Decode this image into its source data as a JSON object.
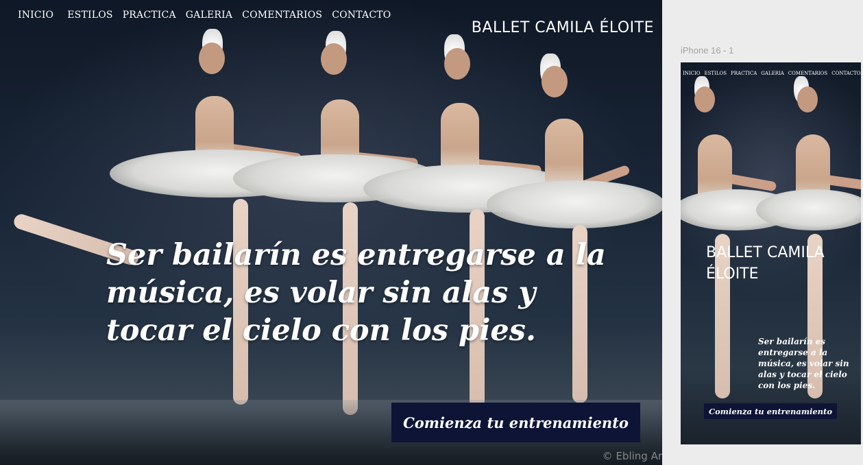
{
  "desktop": {
    "nav": [
      "INICIO",
      "ESTILOS",
      "PRACTICA",
      "GALERIA",
      "COMENTARIOS",
      "CONTACTO"
    ],
    "brand": "BALLET CAMILA ÉLOITE",
    "quote": "Ser bailarín es entregarse a la música, es volar sin alas y tocar el cielo con los pies.",
    "cta": "Comienza tu entrenamiento",
    "photo_credit": "© Ebling Ar"
  },
  "phone": {
    "frame_label": "iPhone 16 - 1",
    "nav": [
      "INICIO",
      "ESTILOS",
      "PRACTICA",
      "GALERIA",
      "COMENTARIOS",
      "CONTACTO"
    ],
    "brand": "BALLET CAMILA ÉLOITE",
    "quote": "Ser bailarín es entregarse a la música, es volar sin alas y tocar el cielo con los pies.",
    "cta": "Comienza tu entrenamiento"
  },
  "colors": {
    "cta_background": "#0e1436",
    "text": "#ffffff",
    "canvas": "#ececec"
  }
}
